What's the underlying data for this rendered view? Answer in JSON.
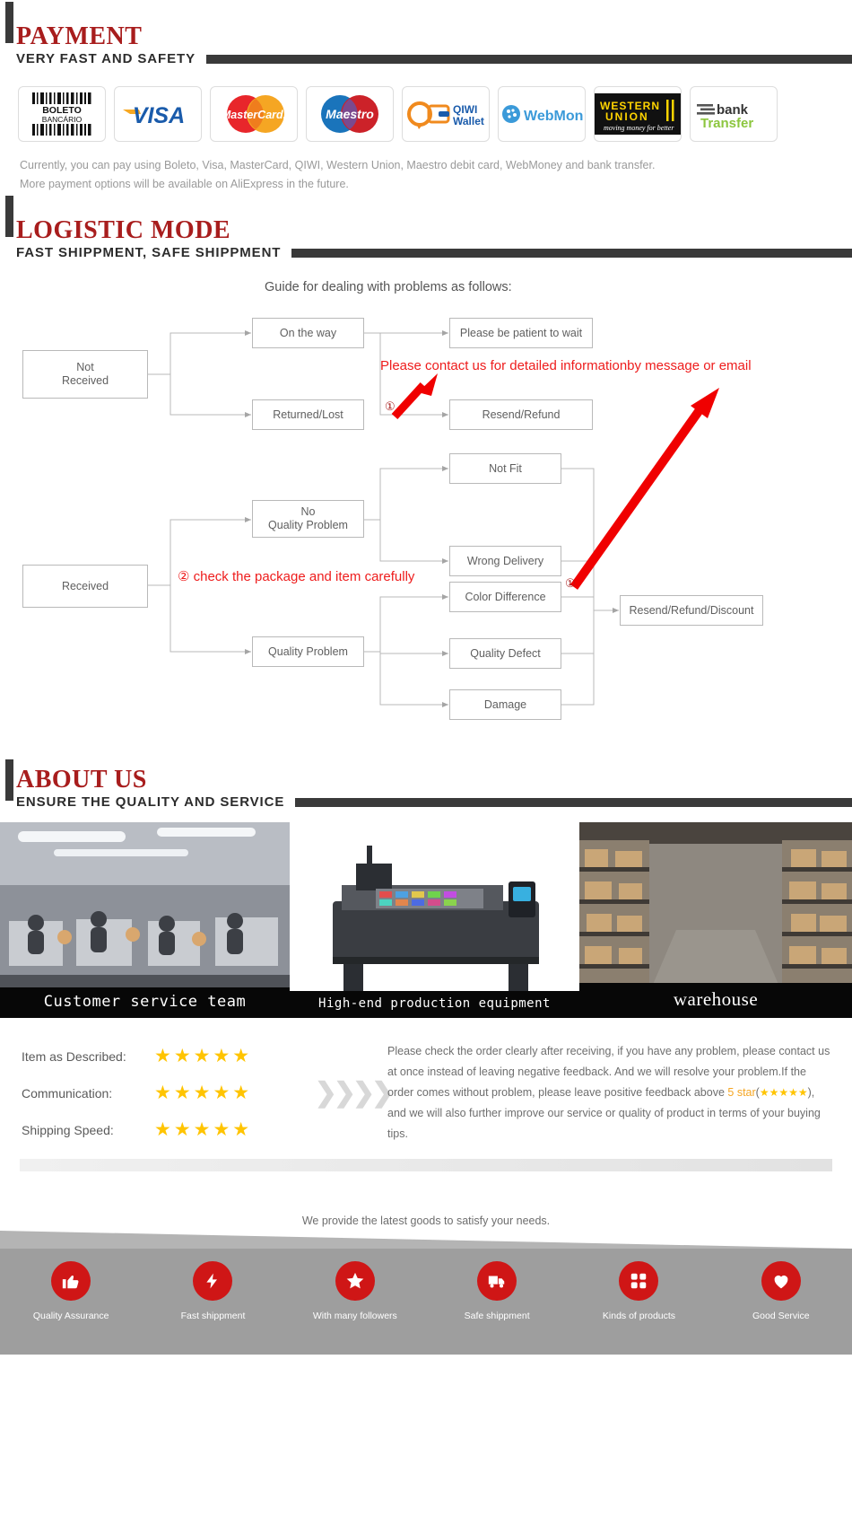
{
  "payment": {
    "title": "PAYMENT",
    "subtitle": "VERY FAST AND SAFETY",
    "logos": [
      {
        "name": "boleto-bancario-logo",
        "label": "BOLETO BANCARIO"
      },
      {
        "name": "visa-logo",
        "label": "VISA"
      },
      {
        "name": "mastercard-logo",
        "label": "MasterCard"
      },
      {
        "name": "maestro-logo",
        "label": "Maestro"
      },
      {
        "name": "qiwi-wallet-logo",
        "label": "QIWI Wallet"
      },
      {
        "name": "webmoney-logo",
        "label": "WebMoney"
      },
      {
        "name": "western-union-logo",
        "label": "WESTERN UNION moving money for better"
      },
      {
        "name": "bank-transfer-logo",
        "label": "bank transfer"
      }
    ],
    "note_line1": "Currently, you can pay using Boleto, Visa, MasterCard, QIWI, Western Union, Maestro debit card, WebMoney and bank transfer.",
    "note_line2": "More payment options will be available on AliExpress in the future."
  },
  "logistic": {
    "title": "LOGISTIC MODE",
    "subtitle": "FAST SHIPPMENT, SAFE SHIPPMENT",
    "flow_title": "Guide for dealing with problems as follows:",
    "nodes": {
      "not_received": "Not\nReceived",
      "on_the_way": "On the way",
      "returned_lost": "Returned/Lost",
      "please_wait": "Please be patient to wait",
      "resend_refund": "Resend/Refund",
      "received": "Received",
      "no_quality_problem": "No\nQuality Problem",
      "quality_problem": "Quality Problem",
      "not_fit": "Not Fit",
      "wrong_delivery": "Wrong Delivery",
      "color_difference": "Color Difference",
      "quality_defect": "Quality Defect",
      "damage": "Damage",
      "resend_refund_discount": "Resend/Refund/Discount"
    },
    "red_note_1": "Please contact us for detailed informationby message or email",
    "red_note_2": "② check the package and item carefully",
    "marker_1": "①",
    "marker_2": "①",
    "marker_3": "①"
  },
  "about": {
    "title": "ABOUT US",
    "subtitle": "ENSURE THE QUALITY AND SERVICE",
    "photos": [
      {
        "name": "photo-customer-service",
        "caption": "Customer service team"
      },
      {
        "name": "photo-production-equipment",
        "caption": "High-end production equipment"
      },
      {
        "name": "photo-warehouse",
        "caption": "warehouse"
      }
    ]
  },
  "ratings": {
    "rows": [
      {
        "label": "Item as Described:",
        "stars": "★★★★★"
      },
      {
        "label": "Communication:",
        "stars": "★★★★★"
      },
      {
        "label": "Shipping Speed:",
        "stars": "★★★★★"
      }
    ],
    "chevrons": "❯❯❯❯",
    "feedback_part1": "Please check the order clearly after receiving, if you have any problem, please contact us at once instead of leaving negative feedback. And we will resolve your problem.If the order comes without problem, please leave positive feedback above ",
    "feedback_highlight": "5 star",
    "feedback_part2": "(",
    "feedback_stars": "★★★★★",
    "feedback_part3": "), and we will also further improve our service or quality of product in terms of your buying tips."
  },
  "tagline": "We provide the latest goods to satisfy your needs.",
  "features": [
    {
      "icon": "thumbs-up-icon",
      "glyph": "👍",
      "label": "Quality Assurance"
    },
    {
      "icon": "lightning-bolt-icon",
      "glyph": "⚡",
      "label": "Fast shippment"
    },
    {
      "icon": "star-icon",
      "glyph": "★",
      "label": "With many followers"
    },
    {
      "icon": "truck-icon",
      "glyph": "🚚",
      "label": "Safe shippment"
    },
    {
      "icon": "grid-products-icon",
      "glyph": "❊",
      "label": "Kinds of products"
    },
    {
      "icon": "heart-icon",
      "glyph": "❤",
      "label": "Good Service"
    }
  ],
  "colors": {
    "accent_red": "#a81d1d",
    "bright_red": "#ee1c1c",
    "dark_bar": "#3a3a3a",
    "star_yellow": "#ffc400"
  }
}
